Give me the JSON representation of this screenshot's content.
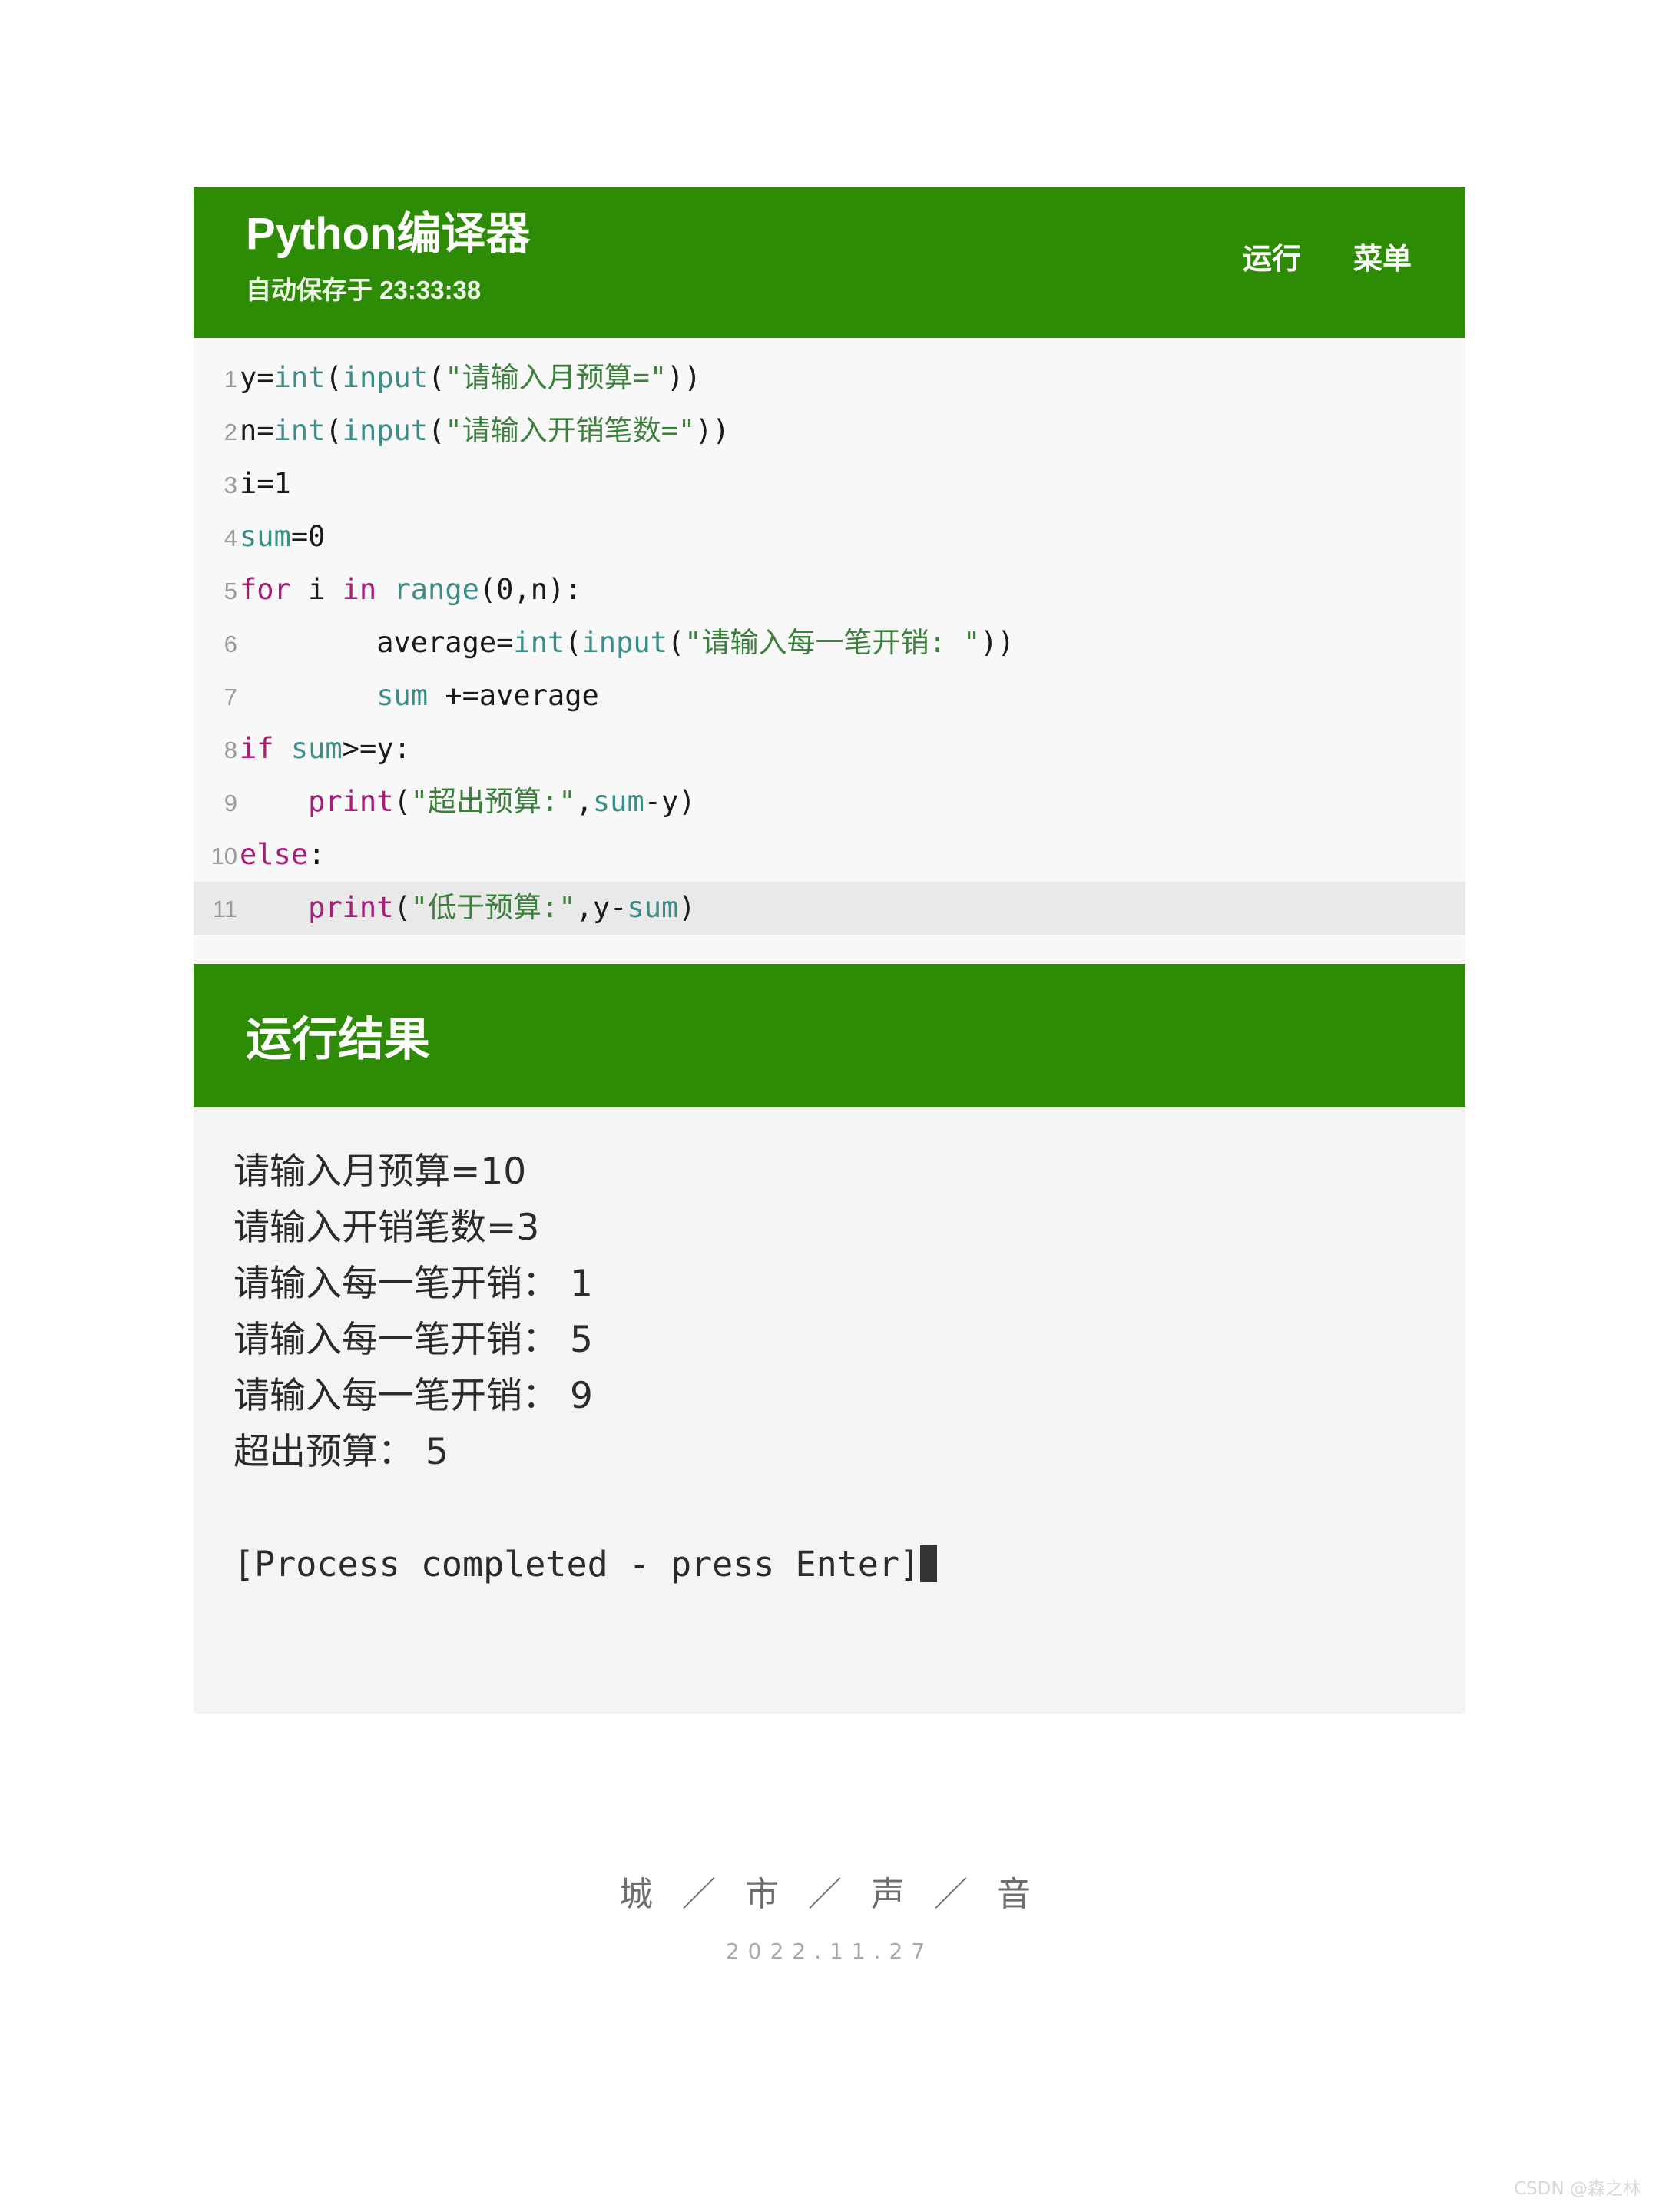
{
  "app": {
    "title": "Python编译器",
    "autosave": "自动保存于 23:33:38",
    "run_label": "运行",
    "menu_label": "菜单"
  },
  "editor": {
    "active_line": 11,
    "lines": [
      {
        "no": "1",
        "tokens": [
          {
            "t": "plain",
            "v": "y="
          },
          {
            "t": "fn",
            "v": "int"
          },
          {
            "t": "plain",
            "v": "("
          },
          {
            "t": "fn",
            "v": "input"
          },
          {
            "t": "plain",
            "v": "("
          },
          {
            "t": "str",
            "v": "\"请输入月预算=\""
          },
          {
            "t": "plain",
            "v": "))"
          }
        ]
      },
      {
        "no": "2",
        "tokens": [
          {
            "t": "plain",
            "v": "n="
          },
          {
            "t": "fn",
            "v": "int"
          },
          {
            "t": "plain",
            "v": "("
          },
          {
            "t": "fn",
            "v": "input"
          },
          {
            "t": "plain",
            "v": "("
          },
          {
            "t": "str",
            "v": "\"请输入开销笔数=\""
          },
          {
            "t": "plain",
            "v": "))"
          }
        ]
      },
      {
        "no": "3",
        "tokens": [
          {
            "t": "plain",
            "v": "i=1"
          }
        ]
      },
      {
        "no": "4",
        "tokens": [
          {
            "t": "var",
            "v": "sum"
          },
          {
            "t": "plain",
            "v": "=0"
          }
        ]
      },
      {
        "no": "5",
        "tokens": [
          {
            "t": "kw",
            "v": "for"
          },
          {
            "t": "plain",
            "v": " i "
          },
          {
            "t": "kw",
            "v": "in"
          },
          {
            "t": "plain",
            "v": " "
          },
          {
            "t": "fn",
            "v": "range"
          },
          {
            "t": "plain",
            "v": "(0,n):"
          }
        ]
      },
      {
        "no": "6",
        "tokens": [
          {
            "t": "plain",
            "v": "        average="
          },
          {
            "t": "fn",
            "v": "int"
          },
          {
            "t": "plain",
            "v": "("
          },
          {
            "t": "fn",
            "v": "input"
          },
          {
            "t": "plain",
            "v": "("
          },
          {
            "t": "str",
            "v": "\"请输入每一笔开销: \""
          },
          {
            "t": "plain",
            "v": "))"
          }
        ]
      },
      {
        "no": "7",
        "tokens": [
          {
            "t": "plain",
            "v": "        "
          },
          {
            "t": "var",
            "v": "sum"
          },
          {
            "t": "plain",
            "v": " +=average"
          }
        ]
      },
      {
        "no": "8",
        "tokens": [
          {
            "t": "kw",
            "v": "if"
          },
          {
            "t": "plain",
            "v": " "
          },
          {
            "t": "var",
            "v": "sum"
          },
          {
            "t": "plain",
            "v": ">=y:"
          }
        ]
      },
      {
        "no": "9",
        "tokens": [
          {
            "t": "plain",
            "v": "    "
          },
          {
            "t": "kw",
            "v": "print"
          },
          {
            "t": "plain",
            "v": "("
          },
          {
            "t": "str",
            "v": "\"超出预算:\""
          },
          {
            "t": "plain",
            "v": ","
          },
          {
            "t": "var",
            "v": "sum"
          },
          {
            "t": "plain",
            "v": "-y)"
          }
        ]
      },
      {
        "no": "10",
        "tokens": [
          {
            "t": "kw",
            "v": "else"
          },
          {
            "t": "plain",
            "v": ":"
          }
        ]
      },
      {
        "no": "11",
        "tokens": [
          {
            "t": "plain",
            "v": "    "
          },
          {
            "t": "kw",
            "v": "print"
          },
          {
            "t": "plain",
            "v": "("
          },
          {
            "t": "str",
            "v": "\"低于预算:\""
          },
          {
            "t": "plain",
            "v": ","
          },
          {
            "t": "plain",
            "v": "y-"
          },
          {
            "t": "var",
            "v": "sum"
          },
          {
            "t": "plain",
            "v": ")"
          }
        ]
      }
    ]
  },
  "results": {
    "header": "运行结果",
    "output_lines": [
      "请输入月预算=10",
      "请输入开销笔数=3",
      "请输入每一笔开销： 1",
      "请输入每一笔开销： 5",
      "请输入每一笔开销： 9",
      "超出预算： 5"
    ],
    "process_message": "[Process completed - press Enter]"
  },
  "footer": {
    "title": "城 ／ 市 ／ 声 ／ 音",
    "date": "2022.11.27"
  },
  "watermark": "CSDN @森之林",
  "colors": {
    "brand_green": "#2e8b06",
    "editor_bg": "#f8f8f8",
    "active_line_bg": "#e9e9e9",
    "console_bg": "#f4f4f4",
    "token_function": "#3c8c88",
    "token_string": "#3d7f3d",
    "token_keyword": "#a61d7a"
  }
}
